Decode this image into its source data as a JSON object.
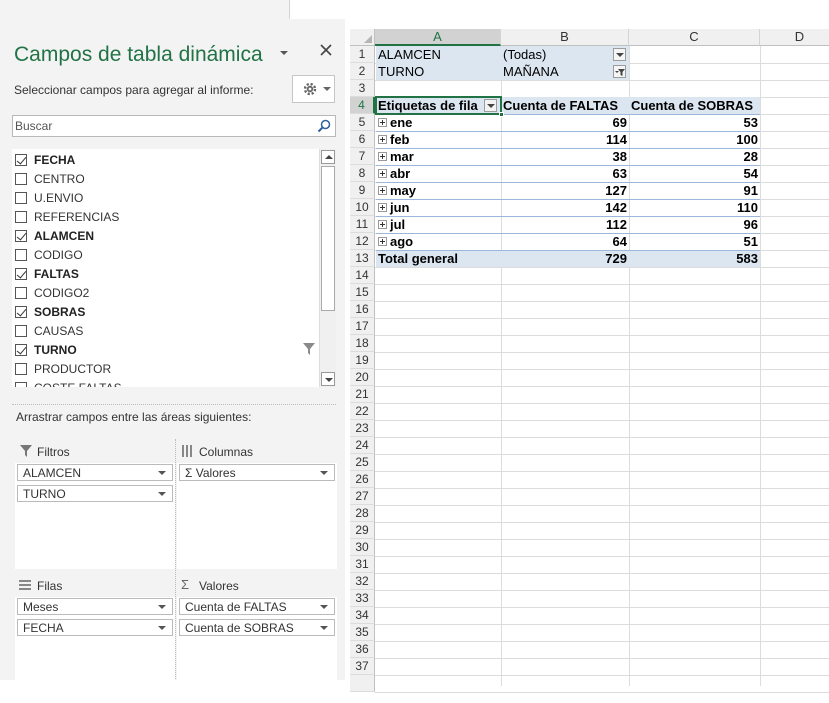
{
  "pane": {
    "title": "Campos de tabla dinámica",
    "subtitle": "Seleccionar campos para agregar al informe:",
    "search_placeholder": "Buscar",
    "fields": [
      {
        "label": "FECHA",
        "checked": true
      },
      {
        "label": "CENTRO",
        "checked": false
      },
      {
        "label": "U.ENVIO",
        "checked": false
      },
      {
        "label": "REFERENCIAS",
        "checked": false
      },
      {
        "label": "ALAMCEN",
        "checked": true
      },
      {
        "label": "CODIGO",
        "checked": false
      },
      {
        "label": "FALTAS",
        "checked": true
      },
      {
        "label": "CODIGO2",
        "checked": false
      },
      {
        "label": "SOBRAS",
        "checked": true
      },
      {
        "label": "CAUSAS",
        "checked": false
      },
      {
        "label": "TURNO",
        "checked": true
      },
      {
        "label": "PRODUCTOR",
        "checked": false
      },
      {
        "label": "COSTE FALTAS",
        "checked": false
      }
    ],
    "areas_label": "Arrastrar campos entre las áreas siguientes:",
    "areas": {
      "filters": {
        "label": "Filtros",
        "items": [
          "ALAMCEN",
          "TURNO"
        ]
      },
      "columns": {
        "label": "Columnas",
        "items": [
          "Valores"
        ]
      },
      "rows": {
        "label": "Filas",
        "items": [
          "Meses",
          "FECHA"
        ]
      },
      "values": {
        "label": "Valores",
        "items": [
          "Cuenta de FALTAS",
          "Cuenta de SOBRAS"
        ]
      }
    }
  },
  "sheet": {
    "columns": [
      "A",
      "B",
      "C",
      "D"
    ],
    "selected_column": "A",
    "selected_row": 4,
    "row_count": 37,
    "filters": [
      {
        "field": "ALAMCEN",
        "value": "(Todas)"
      },
      {
        "field": "TURNO",
        "value": "MAÑANA"
      }
    ],
    "header": {
      "row_labels": "Etiquetas de fila",
      "col_b": "Cuenta de FALTAS",
      "col_c": "Cuenta de SOBRAS"
    },
    "rows": [
      {
        "label": "ene",
        "faltas": "69",
        "sobras": "53"
      },
      {
        "label": "feb",
        "faltas": "114",
        "sobras": "100"
      },
      {
        "label": "mar",
        "faltas": "38",
        "sobras": "28"
      },
      {
        "label": "abr",
        "faltas": "63",
        "sobras": "54"
      },
      {
        "label": "may",
        "faltas": "127",
        "sobras": "91"
      },
      {
        "label": "jun",
        "faltas": "142",
        "sobras": "110"
      },
      {
        "label": "jul",
        "faltas": "112",
        "sobras": "96"
      },
      {
        "label": "ago",
        "faltas": "64",
        "sobras": "51"
      }
    ],
    "total": {
      "label": "Total general",
      "faltas": "729",
      "sobras": "583"
    }
  },
  "colors": {
    "accent": "#217346",
    "pivot_header_bg": "#dce6f1"
  }
}
